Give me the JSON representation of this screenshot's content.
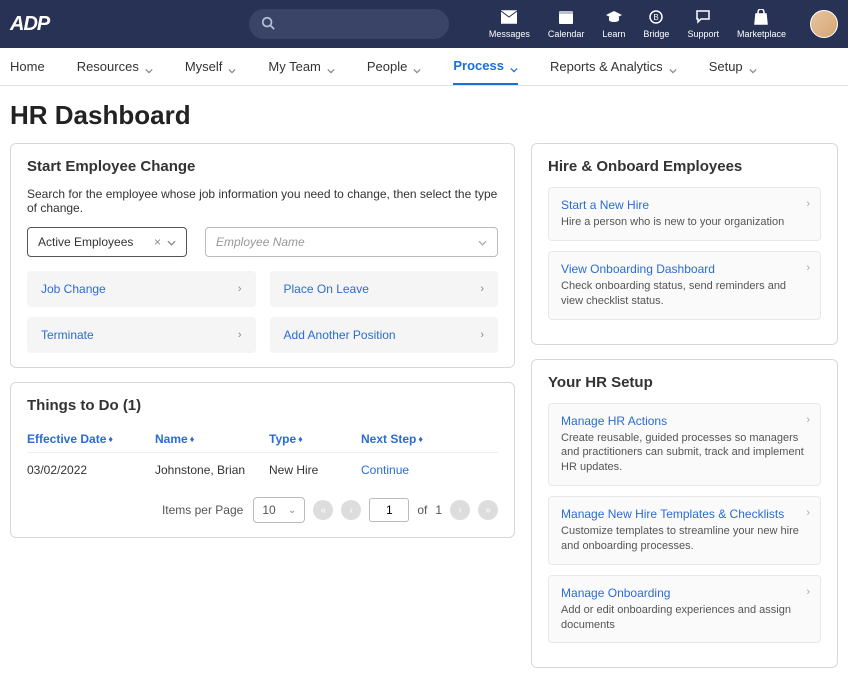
{
  "brand": "ADP",
  "top_icons": [
    {
      "key": "messages",
      "label": "Messages",
      "icon": "mail"
    },
    {
      "key": "calendar",
      "label": "Calendar",
      "icon": "calendar"
    },
    {
      "key": "learn",
      "label": "Learn",
      "icon": "grad"
    },
    {
      "key": "bridge",
      "label": "Bridge",
      "icon": "bridge"
    },
    {
      "key": "support",
      "label": "Support",
      "icon": "chat"
    },
    {
      "key": "marketplace",
      "label": "Marketplace",
      "icon": "bag"
    }
  ],
  "nav": {
    "items": [
      {
        "label": "Home",
        "dd": false
      },
      {
        "label": "Resources",
        "dd": true
      },
      {
        "label": "Myself",
        "dd": true
      },
      {
        "label": "My Team",
        "dd": true
      },
      {
        "label": "People",
        "dd": true
      },
      {
        "label": "Process",
        "dd": true,
        "active": true
      },
      {
        "label": "Reports & Analytics",
        "dd": true
      },
      {
        "label": "Setup",
        "dd": true
      }
    ]
  },
  "page_title": "HR Dashboard",
  "start_change": {
    "title": "Start Employee Change",
    "helper": "Search for the employee whose job information you need to change, then select the type of change.",
    "filter_value": "Active Employees",
    "employee_placeholder": "Employee Name",
    "actions": [
      {
        "label": "Job Change"
      },
      {
        "label": "Place On Leave"
      },
      {
        "label": "Terminate"
      },
      {
        "label": "Add Another Position"
      }
    ]
  },
  "todo": {
    "title": "Things to Do (1)",
    "columns": {
      "effective": "Effective Date",
      "name": "Name",
      "type": "Type",
      "next": "Next Step"
    },
    "rows": [
      {
        "effective": "03/02/2022",
        "name": "Johnstone, Brian",
        "type": "New Hire",
        "next": "Continue"
      }
    ],
    "pager": {
      "items_label": "Items per Page",
      "per_page": "10",
      "page": "1",
      "of_label": "of",
      "total": "1"
    }
  },
  "hire": {
    "title": "Hire & Onboard Employees",
    "items": [
      {
        "title": "Start a New Hire",
        "desc": "Hire a person who is new to your organization"
      },
      {
        "title": "View Onboarding Dashboard",
        "desc": "Check onboarding status, send reminders and view checklist status."
      }
    ]
  },
  "setup": {
    "title": "Your HR Setup",
    "items": [
      {
        "title": "Manage HR Actions",
        "desc": "Create reusable, guided processes so managers and practitioners can submit, track and implement HR updates."
      },
      {
        "title": "Manage New Hire Templates & Checklists",
        "desc": "Customize templates to streamline your new hire and onboarding processes."
      },
      {
        "title": "Manage Onboarding",
        "desc": "Add or edit onboarding experiences and assign documents"
      }
    ]
  }
}
